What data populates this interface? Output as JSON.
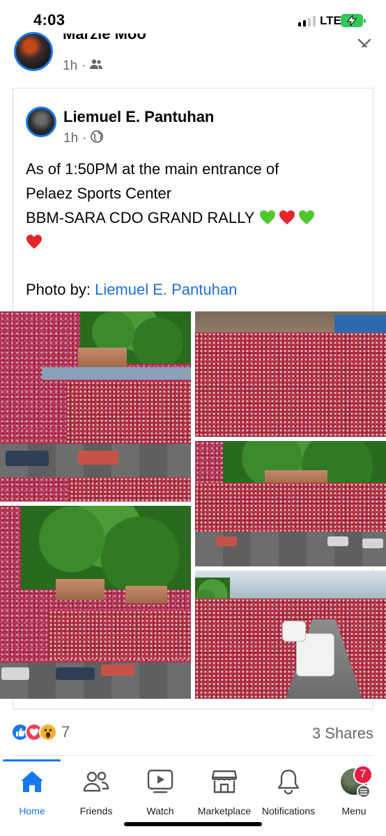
{
  "status_bar": {
    "time": "4:03",
    "network": "LTE",
    "signal_level": 0.5,
    "battery_charging": true,
    "battery_color": "#34c759"
  },
  "outer_post": {
    "author": "Marzie Moo",
    "time": "1h",
    "separator": "·",
    "audience_icon": "friends-audience-icon"
  },
  "shared_post": {
    "author": "Liemuel E. Pantuhan",
    "time": "1h",
    "separator": "·",
    "audience_icon": "globe-public-icon",
    "text_line1": "As of 1:50PM  at the main entrance of",
    "text_line2": "Pelaez Sports Center",
    "text_line3": "BBM-SARA CDO GRAND RALLY",
    "emoji_sequence": [
      "green-heart",
      "red-heart",
      "green-heart",
      "red-heart"
    ],
    "photo_credit_label": "Photo by: ",
    "photo_credit_link": "Liemuel E. Pantuhan",
    "photos": [
      {
        "name": "aerial-crowd-street"
      },
      {
        "name": "street-crowd-red-shirts"
      },
      {
        "name": "aerial-crowd-road"
      },
      {
        "name": "aerial-crowd-trees"
      },
      {
        "name": "street-crowd-white-van"
      }
    ]
  },
  "engagement": {
    "reaction_count": "7",
    "reactions": [
      "like",
      "love",
      "wow"
    ],
    "shares": "3 Shares"
  },
  "bottom_nav": {
    "items": [
      {
        "label": "Home",
        "icon": "home-icon",
        "active": true
      },
      {
        "label": "Friends",
        "icon": "friends-icon",
        "active": false
      },
      {
        "label": "Watch",
        "icon": "watch-icon",
        "active": false
      },
      {
        "label": "Marketplace",
        "icon": "marketplace-icon",
        "active": false
      },
      {
        "label": "Notifications",
        "icon": "bell-icon",
        "active": false
      },
      {
        "label": "Menu",
        "icon": "menu-avatar-icon",
        "active": false
      }
    ],
    "menu_badge": "7",
    "accent_color": "#1877f2",
    "badge_color": "#e41e3f"
  }
}
